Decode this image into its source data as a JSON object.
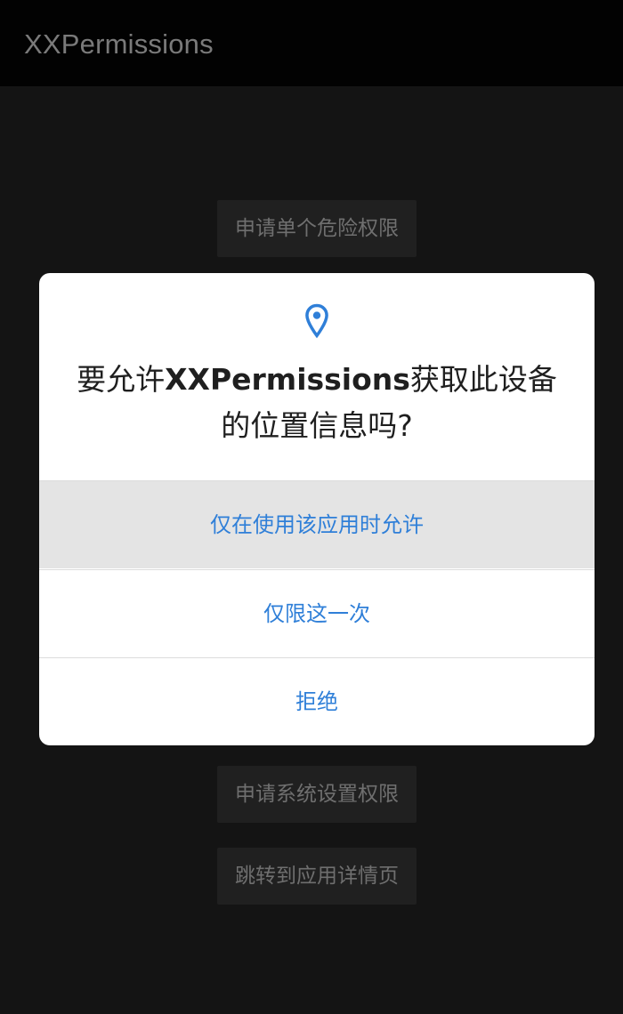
{
  "app": {
    "title": "XXPermissions"
  },
  "background_buttons": [
    {
      "label": "申请单个危险权限"
    },
    {
      "label": "申请系统设置权限"
    },
    {
      "label": "跳转到应用详情页"
    }
  ],
  "dialog": {
    "icon": "location-pin-icon",
    "title_prefix": "要允许",
    "title_app": "XXPermissions",
    "title_suffix": "获取此设备的位置信息吗?",
    "options": [
      {
        "label": "仅在使用该应用时允许",
        "selected": true
      },
      {
        "label": "仅限这一次",
        "selected": false
      },
      {
        "label": "拒绝",
        "selected": false
      }
    ]
  },
  "colors": {
    "accent": "#2f7fd8",
    "background": "#141414",
    "appbar": "#020202",
    "dialog": "#ffffff",
    "selected_option": "#e4e4e4"
  }
}
